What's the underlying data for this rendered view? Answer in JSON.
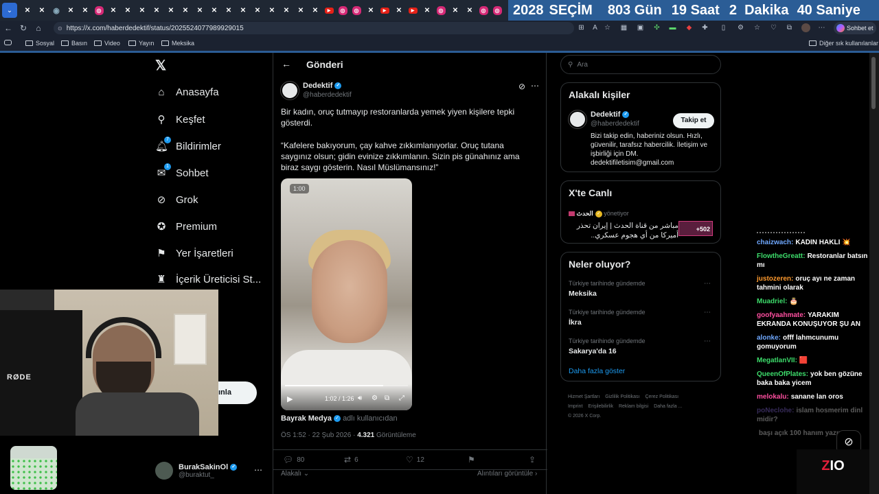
{
  "browser": {
    "url": "https://x.com/haberdedektif/status/2025524077989929015",
    "chat_label": "Sohbet et",
    "tab_icons": [
      "x-icon",
      "x-icon",
      "gen-icon",
      "x-icon",
      "x-icon",
      "instagram-icon",
      "x-icon",
      "x-icon",
      "x-icon",
      "x-icon",
      "x-icon",
      "x-icon",
      "x-icon",
      "x-icon",
      "x-icon",
      "x-icon",
      "x-icon",
      "x-icon",
      "x-icon",
      "x-icon",
      "x-icon",
      "youtube-icon",
      "instagram-icon",
      "instagram-icon",
      "x-icon",
      "youtube-icon",
      "x-icon",
      "youtube-icon",
      "x-icon",
      "instagram-icon",
      "x-icon",
      "x-icon",
      "instagram-icon",
      "instagram-icon",
      "x-icon"
    ],
    "bookmarks": [
      "Sosyal",
      "Basın",
      "Video",
      "Yayın",
      "Meksika"
    ],
    "other_bookmarks": "Diğer sık kullanılanlar"
  },
  "countdown": {
    "year": "2028",
    "label": "SEÇİM",
    "days": "803 Gün",
    "hours": "19 Saat",
    "minutes": "2  Dakika",
    "seconds": "40 Saniye"
  },
  "sidebar": {
    "logo": "𝕏",
    "items": [
      {
        "label": "Anasayfa",
        "icon": "home-icon",
        "glyph": "⌂"
      },
      {
        "label": "Keşfet",
        "icon": "search-icon",
        "glyph": "⚲"
      },
      {
        "label": "Bildirimler",
        "icon": "bell-icon",
        "glyph": "🔔︎",
        "badge": "7"
      },
      {
        "label": "Sohbet",
        "icon": "mail-icon",
        "glyph": "✉",
        "badge": "1"
      },
      {
        "label": "Grok",
        "icon": "grok-icon",
        "glyph": "⊘"
      },
      {
        "label": "Premium",
        "icon": "premium-icon",
        "glyph": "✪"
      },
      {
        "label": "Yer İşaretleri",
        "icon": "bookmark-icon",
        "glyph": "⚑"
      },
      {
        "label": "İçerik Üreticisi St...",
        "icon": "creator-icon",
        "glyph": "♜"
      }
    ],
    "post_button": "ınla",
    "profile": {
      "name": "BurakSakinOl",
      "handle": "@buraktut_"
    }
  },
  "main": {
    "header": "Gönderi",
    "author": {
      "name": "Dedektif",
      "handle": "@haberdedektif"
    },
    "text1": "Bir kadın, oruç tutmayıp restoranlarda yemek yiyen kişilere tepki gösterdi.",
    "text2": "“Kafelere bakıyorum, çay kahve zıkkımlanıyorlar. Oruç tutana saygınız olsun; gidin evinize zıkkımlanın. Sizin pis günahınız ama biraz saygı gösterin. Nasıl Müslümansınız!”",
    "video": {
      "badge": "1:00",
      "time": "1:02 / 1:26",
      "progress": 0.8
    },
    "byline_name": "Bayrak Medya",
    "byline_suffix": "adlı kullanıcıdan",
    "meta_time": "ÖS 1:52 · 22 Şub 2026 · ",
    "meta_views": "4.321",
    "meta_views_label": " Görüntüleme",
    "actions": {
      "replies": "80",
      "reposts": "6",
      "likes": "12"
    },
    "sort": "Alakalı",
    "quotes": "Alıntıları görüntüle"
  },
  "right": {
    "search_placeholder": "Ara",
    "people_title": "Alakalı kişiler",
    "person": {
      "name": "Dedektif",
      "handle": "@haberdedektif",
      "follow": "Takip et",
      "bio": "Bizi takip edin, haberiniz olsun. Hızlı, güvenilir, tarafsız habercilik. İletişim ve işbirliği için DM. dedektifiletisim@gmail.com"
    },
    "live_title": "X'te Canlı",
    "live_host": "الحدث",
    "live_host_status": "yönetiyor",
    "live_text": "مباشر من قناة الحدث | إيران تحذر أميركا من أي هجوم عسكري..",
    "live_count": "+502",
    "trends_title": "Neler oluyor?",
    "trends": [
      {
        "ctx": "Türkiye tarihinde gündemde",
        "name": "Meksika"
      },
      {
        "ctx": "Türkiye tarihinde gündemde",
        "name": "İkra"
      },
      {
        "ctx": "Türkiye tarihinde gündemde",
        "name": "Sakarya'da 16"
      }
    ],
    "show_more": "Daha fazla göster",
    "footer": [
      "Hizmet Şartları",
      "Gizlilik Politikası",
      "Çerez Politikası",
      "Imprint",
      "Erişilebilirlik",
      "Reklam bilgisi",
      "Daha fazla ...",
      "© 2026 X Corp."
    ]
  },
  "chat": [
    {
      "user": "chaizwach:",
      "text": "KADIN HAKLI 💥",
      "color": "#6fa8ff"
    },
    {
      "user": "FlowtheGreatt:",
      "text": "Restoranlar batsın mı",
      "color": "#3ddc6b"
    },
    {
      "user": "justozeren:",
      "text": "oruç ayı ne zaman tahmini olarak",
      "color": "#ff9a2e"
    },
    {
      "user": "Muadriel:",
      "text": "🎂",
      "color": "#3ddc6b"
    },
    {
      "user": "goofyaahmate:",
      "text": "YARAKIM EKRANDA KONUŞUYOR ŞU AN",
      "color": "#ff4fa0"
    },
    {
      "user": "alonke:",
      "text": "offf lahmcunumu gomuyorum",
      "color": "#6fa8ff"
    },
    {
      "user": "MegatlanVII:",
      "text": "🟥",
      "color": "#3ddc6b"
    },
    {
      "user": "QueenOfPlates:",
      "text": "yok ben gözüne baka baka yicem",
      "color": "#3ddc6b"
    },
    {
      "user": "melokalu:",
      "text": "sanane lan oros",
      "color": "#ff4fa0"
    },
    {
      "user": "poNeclohe:",
      "text": "islam hosmerim dinl midir?",
      "color": "#9d7bff"
    },
    {
      "user": "",
      "text": "başı açık 100 hanım yazıyorum",
      "color": "#888"
    }
  ],
  "cam": {
    "mic_label": "RØDE"
  },
  "brand": {
    "zi": "Z",
    "o": "IO"
  }
}
